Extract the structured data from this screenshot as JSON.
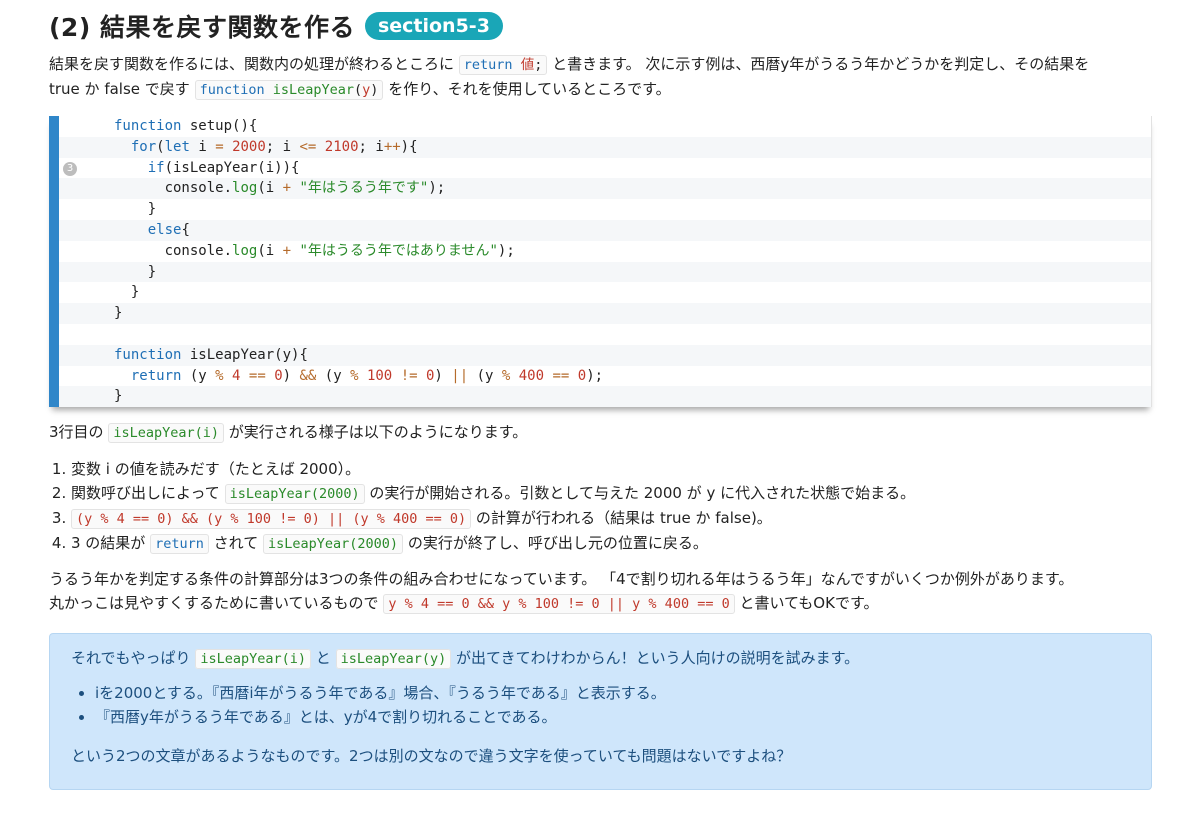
{
  "header": {
    "title": "(2) 結果を戻す関数を作る",
    "badge": "section5-3"
  },
  "intro": {
    "t1": "結果を戻す関数を作るには、関数内の処理が終わるところに",
    "code1a": "return",
    "code1b": "値",
    "code1c": ";",
    "t2": "と書きます。 次に示す例は、西暦y年がうるう年かどうかを判定し、その結果を",
    "t3": "true か false で戻す",
    "code2a": "function",
    "code2b": "isLeapYear",
    "code2c": "(",
    "code2d": "y",
    "code2e": ")",
    "t4": "を作り、それを使用しているところです。"
  },
  "code": {
    "marker": "3",
    "lines": [
      "function setup(){",
      "  for(let i = 2000; i <= 2100; i++){",
      "    if(isLeapYear(i)){",
      "      console.log(i + \"年はうるう年です\");",
      "    }",
      "    else{",
      "      console.log(i + \"年はうるう年ではありません\");",
      "    }",
      "  }",
      "}",
      "",
      "function isLeapYear(y){",
      "  return (y % 4 == 0) && (y % 100 != 0) || (y % 400 == 0);",
      "}"
    ]
  },
  "after": {
    "t1": "3行目の",
    "code": "isLeapYear(i)",
    "t2": "が実行される様子は以下のようになります。"
  },
  "steps": {
    "s1": "変数 i の値を読みだす（たとえば 2000）。",
    "s2a": "関数呼び出しによって",
    "s2code": "isLeapYear(2000)",
    "s2b": "の実行が開始される。引数として与えた 2000 が y に代入された状態で始まる。",
    "s3code": "(y % 4 == 0) && (y % 100 != 0) || (y % 400 == 0)",
    "s3b": "の計算が行われる（結果は true か false)。",
    "s4a": "3 の結果が",
    "s4code1": "return",
    "s4b": "されて",
    "s4code2": "isLeapYear(2000)",
    "s4c": "の実行が終了し、呼び出し元の位置に戻る。"
  },
  "para2": {
    "l1": "うるう年かを判定する条件の計算部分は3つの条件の組み合わせになっています。 「4で割り切れる年はうるう年」なんですがいくつか例外があります。",
    "l2a": "丸かっこは見やすくするために書いているもので",
    "l2code": "y % 4 == 0 && y % 100 != 0 || y % 400 == 0",
    "l2b": "と書いてもOKです。"
  },
  "note": {
    "t1": "それでもやっぱり",
    "code1": "isLeapYear(i)",
    "t2": "と",
    "code2": "isLeapYear(y)",
    "t3": "が出てきてわけわからん！という人向けの説明を試みます。",
    "bullets": [
      "iを2000とする。『西暦i年がうるう年である』場合、『うるう年である』と表示する。",
      "『西暦y年がうるう年である』とは、yが4で割り切れることである。"
    ],
    "last": "という2つの文章があるようなものです。2つは別の文なので違う文字を使っていても問題はないですよね？"
  },
  "colors": {
    "badge": "#1aa6b7",
    "code_bar": "#2f86c9",
    "note_bg": "#cfe6fb"
  }
}
